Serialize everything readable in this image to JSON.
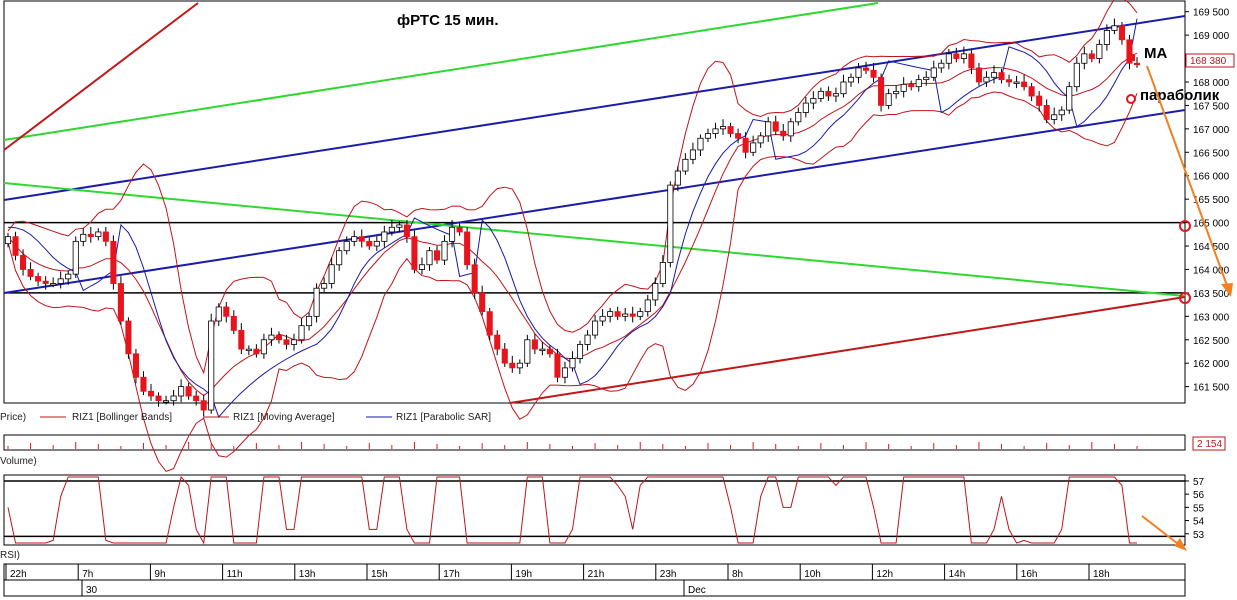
{
  "chart_data": {
    "type": "candlestick",
    "title": "фРТС   15 мин.",
    "price_axis": {
      "ticks": [
        "169 500",
        "169 000",
        "168 500",
        "168 000",
        "167 500",
        "167 000",
        "166 500",
        "166 000",
        "165 500",
        "165 000",
        "164 500",
        "164 000",
        "163 500",
        "163 000",
        "162 500",
        "162 000",
        "161 500"
      ],
      "range": [
        161300,
        169600
      ],
      "last_price": "168 380"
    },
    "volume": {
      "last": "2 154"
    },
    "rsi": {
      "ticks": [
        "57",
        "56",
        "55",
        "54",
        "53"
      ],
      "range": [
        52.3,
        57.3
      ]
    },
    "time_axis": {
      "hour_labels": [
        "22h",
        "7h",
        "9h",
        "11h",
        "13h",
        "15h",
        "17h",
        "19h",
        "21h",
        "23h",
        "8h",
        "10h",
        "12h",
        "14h",
        "16h",
        "18h"
      ],
      "date_labels": [
        "30",
        "Dec"
      ]
    },
    "legend": {
      "price_label": "Price)",
      "bollinger": "RIZ1 [Bollinger Bands]",
      "moving_average": "RIZ1 [Moving Average]",
      "parabolic": "RIZ1 [Parabolic SAR]",
      "volume_label": "Volume)",
      "rsi_label": "RSI)"
    },
    "annotations": {
      "ma": "MA",
      "parabolic": "параболик"
    },
    "colors": {
      "bull": "#ffffff",
      "bear": "#e8141c",
      "wick": "#000000",
      "bollinger": "#c0151b",
      "moving_average": "#c0151b",
      "parabolic": "#1a1aa8",
      "channel": "#1c1caa",
      "green_line": "#2fd82f",
      "red_line": "#c01818",
      "level_line": "#000000",
      "arrow": "#f08020"
    },
    "levels": [
      165000,
      163500
    ],
    "closes": [
      164700,
      164300,
      164000,
      163850,
      163750,
      163700,
      163700,
      163800,
      163900,
      164600,
      164750,
      164700,
      164800,
      164600,
      163700,
      162900,
      162200,
      161700,
      161400,
      161300,
      161200,
      161200,
      161300,
      161500,
      161300,
      161200,
      161000,
      162900,
      163200,
      163000,
      162700,
      162300,
      162300,
      162200,
      162500,
      162600,
      162500,
      162400,
      162500,
      162800,
      163000,
      163600,
      163700,
      164100,
      164400,
      164600,
      164700,
      164600,
      164500,
      164600,
      164800,
      164900,
      164950,
      164700,
      164000,
      164100,
      164400,
      164200,
      164600,
      164900,
      164800,
      164100,
      163500,
      163100,
      162600,
      162300,
      162000,
      161900,
      162000,
      162500,
      162300,
      162300,
      162200,
      161700,
      161900,
      162100,
      162400,
      162600,
      162900,
      163000,
      163100,
      163000,
      163050,
      163000,
      163100,
      163350,
      163700,
      164150,
      165800,
      166100,
      166350,
      166550,
      166800,
      166900,
      167000,
      167050,
      166900,
      166800,
      166500,
      166700,
      166850,
      167150,
      166950,
      166850,
      167150,
      167350,
      167550,
      167650,
      167800,
      167700,
      167750,
      168000,
      168100,
      168300,
      168250,
      168100,
      167500,
      167750,
      167800,
      167950,
      167900,
      168050,
      168100,
      168300,
      168400,
      168600,
      168500,
      168600,
      168300,
      168000,
      168100,
      168200,
      168050,
      168000,
      168000,
      167900,
      167700,
      167500,
      167200,
      167300,
      167400,
      167900,
      168400,
      168600,
      168500,
      168800,
      169100,
      169200,
      168900,
      168400,
      168380
    ]
  }
}
